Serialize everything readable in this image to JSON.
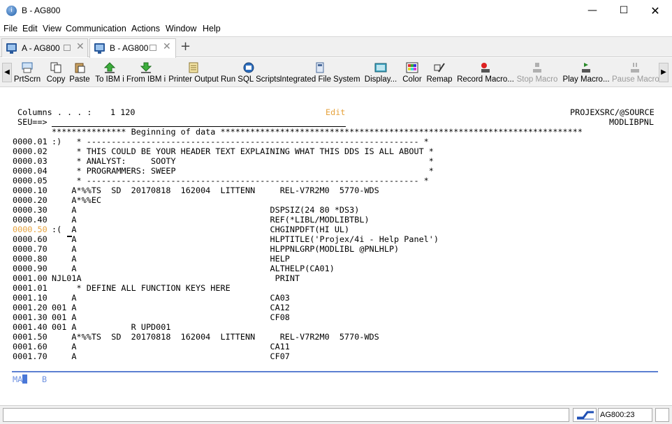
{
  "window": {
    "title": "B - AG800",
    "app_icon": "i",
    "minimize_glyph": "—",
    "maximize_glyph": "☐",
    "close_glyph": "✕"
  },
  "menu": [
    "File",
    "Edit",
    "View",
    "Communication",
    "Actions",
    "Window",
    "Help"
  ],
  "tabs": [
    {
      "label": "A - AG800",
      "active": false
    },
    {
      "label": "B - AG800",
      "active": true
    }
  ],
  "new_tab_glyph": "+",
  "toolbar": {
    "left_arrow": "◀",
    "right_arrow": "▶",
    "tools": [
      {
        "label": "PrtScrn",
        "icon": "print-screen-icon",
        "enabled": true
      },
      {
        "label": "Copy",
        "icon": "copy-icon",
        "enabled": true
      },
      {
        "label": "Paste",
        "icon": "paste-icon",
        "enabled": true
      },
      {
        "label": "To IBM i",
        "icon": "upload-icon",
        "enabled": true
      },
      {
        "label": "From IBM i",
        "icon": "download-icon",
        "enabled": true
      },
      {
        "label": "Printer Output",
        "icon": "printer-output-icon",
        "enabled": true
      },
      {
        "label": "Run SQL Scripts",
        "icon": "sql-scripts-icon",
        "enabled": true
      },
      {
        "label": "Integrated File System",
        "icon": "file-system-icon",
        "enabled": true
      },
      {
        "label": "Display...",
        "icon": "display-icon",
        "enabled": true
      },
      {
        "label": "Color",
        "icon": "color-icon",
        "enabled": true
      },
      {
        "label": "Remap",
        "icon": "remap-icon",
        "enabled": true
      },
      {
        "label": "Record Macro...",
        "icon": "record-macro-icon",
        "enabled": true
      },
      {
        "label": "Stop Macro",
        "icon": "stop-macro-icon",
        "enabled": false
      },
      {
        "label": "Play Macro...",
        "icon": "play-macro-icon",
        "enabled": true
      },
      {
        "label": "Pause Macro",
        "icon": "pause-macro-icon",
        "enabled": false
      }
    ]
  },
  "terminal": {
    "header": {
      "columns_label": "Columns . . . :",
      "columns_value": "1 120",
      "mode": "Edit",
      "source_file": "PROJEXSRC/@SOURCE",
      "prompt": "SEU==>",
      "member": "MODLIBPNL"
    },
    "beginning_banner": "*************** Beginning of data *************************************************************************",
    "lines": [
      {
        "seq": "0000.01",
        "text": ":)   * ------------------------------------------------------------------- *"
      },
      {
        "seq": "0000.02",
        "text": "     * THIS COULD BE YOUR HEADER TEXT EXPLAINING WHAT THIS DDS IS ALL ABOUT *"
      },
      {
        "seq": "0000.03",
        "text": "     * ANALYST:     SOOTY                                                   *"
      },
      {
        "seq": "0000.04",
        "text": "     * PROGRAMMERS: SWEEP                                                   *"
      },
      {
        "seq": "0000.05",
        "text": "     * ------------------------------------------------------------------- *"
      },
      {
        "seq": "0000.10",
        "text": "    A*%%TS  SD  20170818  162004  LITTENN     REL-V7R2M0  5770-WDS"
      },
      {
        "seq": "0000.20",
        "text": "    A*%%EC"
      },
      {
        "seq": "0000.30",
        "text": "    A                                       DSPSIZ(24 80 *DS3)"
      },
      {
        "seq": "0000.40",
        "text": "    A                                       REF(*LIBL/MODLIBTBL)"
      },
      {
        "seq": "0000.50",
        "text": ":(  A                                       CHGINPDFT(HI UL)",
        "active": true
      },
      {
        "seq": "0000.60",
        "text": "    A                                       HLPTITLE('Projex/4i - Help Panel')"
      },
      {
        "seq": "0000.70",
        "text": "    A                                       HLPPNLGRP(MODLIBL @PNLHLP)"
      },
      {
        "seq": "0000.80",
        "text": "    A                                       HELP"
      },
      {
        "seq": "0000.90",
        "text": "    A                                       ALTHELP(CA01)"
      },
      {
        "seq": "0001.00",
        "text": "NJL01A                                       PRINT"
      },
      {
        "seq": "0001.01",
        "text": "     * DEFINE ALL FUNCTION KEYS HERE"
      },
      {
        "seq": "0001.10",
        "text": "    A                                       CA03"
      },
      {
        "seq": "0001.20",
        "text": "001 A                                       CA12"
      },
      {
        "seq": "0001.30",
        "text": "001 A                                       CF08"
      },
      {
        "seq": "0001.40",
        "text": "001 A           R UPD001"
      },
      {
        "seq": "0001.50",
        "text": "    A*%%TS  SD  20170818  162004  LITTENN     REL-V7R2M0  5770-WDS"
      },
      {
        "seq": "0001.60",
        "text": "    A                                       CA11"
      },
      {
        "seq": "0001.70",
        "text": "    A                                       CF07"
      }
    ],
    "oia_left": "MA",
    "oia_right": "B"
  },
  "status": {
    "message": "",
    "session": "AG800:23"
  },
  "colors": {
    "edit_mode": "#e6a23c",
    "oia_line": "#5b7fd1",
    "oia_text": "#6b8fe0"
  }
}
